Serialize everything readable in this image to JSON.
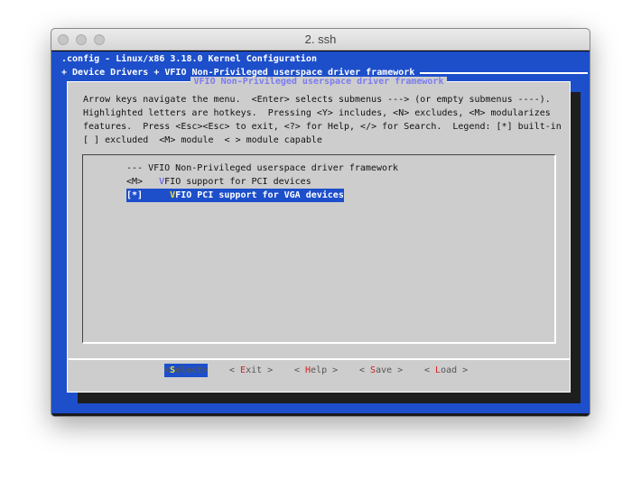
{
  "window": {
    "title": "2. ssh"
  },
  "header": {
    "config_line": ".config - Linux/x86 3.18.0 Kernel Configuration",
    "breadcrumb": "+ Device Drivers + VFIO Non-Privileged userspace driver framework"
  },
  "dialog": {
    "title": "VFIO Non-Privileged userspace driver framework",
    "help_lines": [
      "Arrow keys navigate the menu.  <Enter> selects submenus ---> (or empty submenus ----).",
      "Highlighted letters are hotkeys.  Pressing <Y> includes, <N> excludes, <M> modularizes",
      "features.  Press <Esc><Esc> to exit, <?> for Help, </> for Search.  Legend: [*] built-in",
      "[ ] excluded  <M> module  < > module capable"
    ],
    "menu": [
      {
        "prefix": "",
        "label": "--- VFIO Non-Privileged userspace driver framework",
        "selected": false
      },
      {
        "prefix": "<M>",
        "hotkey": "V",
        "rest": "FIO support for PCI devices",
        "selected": false
      },
      {
        "prefix": "[*]",
        "hotkey": "V",
        "rest": "FIO PCI support for VGA devices",
        "selected": true
      }
    ],
    "buttons": [
      {
        "open": "<",
        "hotkey": "S",
        "rest": "elect",
        "close": ">",
        "selected": true
      },
      {
        "open": "< ",
        "hotkey": "E",
        "rest": "xit",
        "close": " >"
      },
      {
        "open": "< ",
        "hotkey": "H",
        "rest": "elp",
        "close": " >"
      },
      {
        "open": "< ",
        "hotkey": "S",
        "rest": "ave",
        "close": " >"
      },
      {
        "open": "< ",
        "hotkey": "L",
        "rest": "oad",
        "close": " >"
      }
    ]
  },
  "colors": {
    "background": "#1d4fcb",
    "dialog": "#cdcdcd",
    "title": "#7b7bf0",
    "hotkey": "#d42020"
  }
}
